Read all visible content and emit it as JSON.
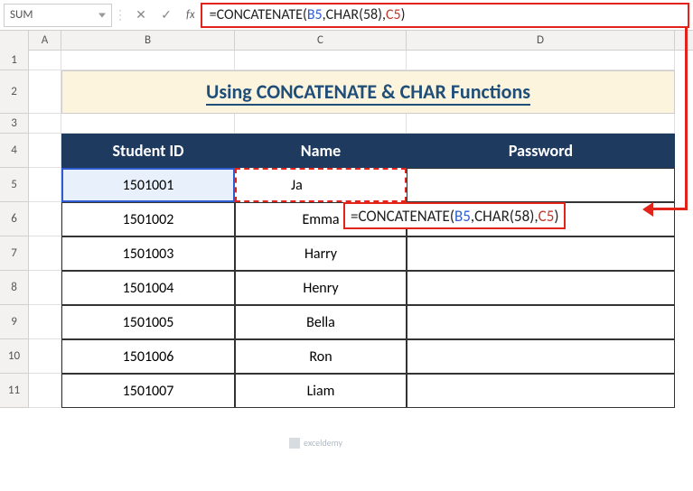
{
  "nameBox": "SUM",
  "fx": "fx",
  "formula": {
    "eq": "=",
    "fn1": "CONCATENATE(",
    "ref1": "B5",
    "mid": ",CHAR(58),",
    "ref2": "C5",
    "close": ")"
  },
  "columns": {
    "a": "A",
    "b": "B",
    "c": "C",
    "d": "D"
  },
  "rowNums": [
    "1",
    "2",
    "3",
    "4",
    "5",
    "6",
    "7",
    "8",
    "9",
    "10",
    "11"
  ],
  "title": "Using CONCATENATE & CHAR Functions",
  "headers": {
    "id": "Student ID",
    "name": "Name",
    "pw": "Password"
  },
  "c5partial": "Ja",
  "chart_data": {
    "type": "table",
    "title": "Using CONCATENATE & CHAR Functions",
    "columns": [
      "Student ID",
      "Name",
      "Password"
    ],
    "rows": [
      {
        "id": "1501001",
        "name": "Ja",
        "pw": "=CONCATENATE(B5,CHAR(58),C5)"
      },
      {
        "id": "1501002",
        "name": "Emma",
        "pw": ""
      },
      {
        "id": "1501003",
        "name": "Harry",
        "pw": ""
      },
      {
        "id": "1501004",
        "name": "Henry",
        "pw": ""
      },
      {
        "id": "1501005",
        "name": "Bella",
        "pw": ""
      },
      {
        "id": "1501006",
        "name": "Ron",
        "pw": ""
      },
      {
        "id": "1501007",
        "name": "Liam",
        "pw": ""
      }
    ]
  },
  "watermark": "exceldemy"
}
